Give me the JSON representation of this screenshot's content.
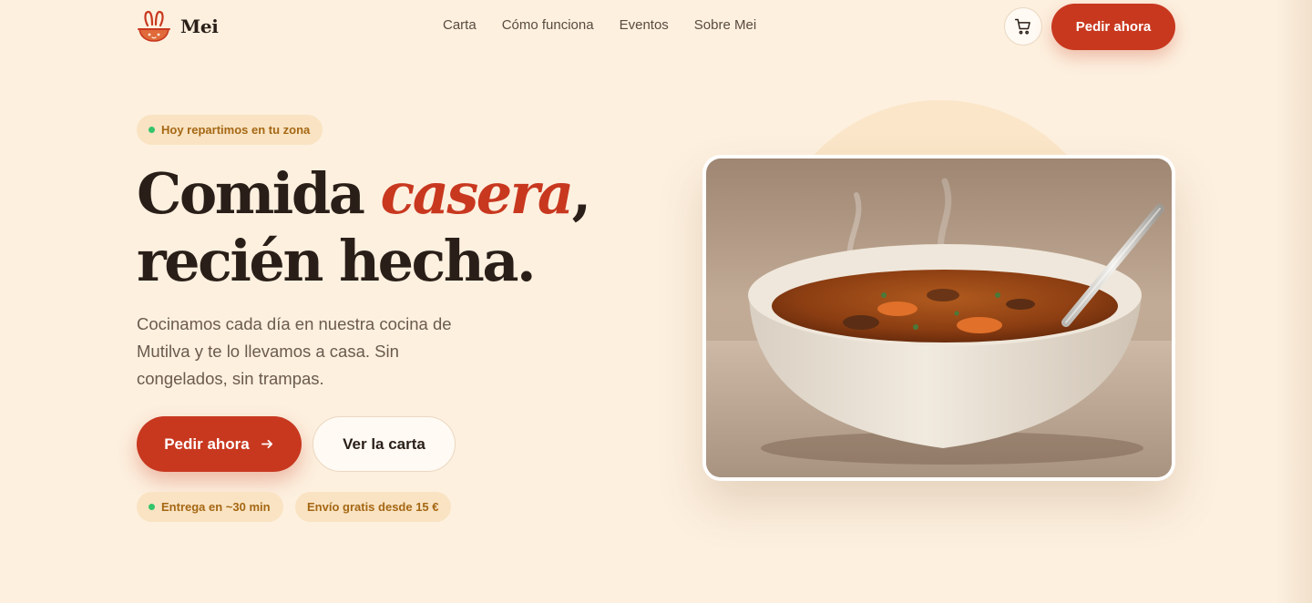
{
  "brand": {
    "name": "Mei",
    "logo_icon": "bowl-bunny-icon",
    "brand_color": "#c8381f"
  },
  "nav": {
    "links": [
      "Carta",
      "Cómo funciona",
      "Eventos",
      "Sobre Mei"
    ],
    "cart_icon": "cart-icon",
    "cta_label": "Pedir ahora"
  },
  "hero": {
    "badge": "Hoy repartimos en tu zona",
    "headline_part1": "Comida ",
    "headline_accent": "casera",
    "headline_part2": ",",
    "headline_line2": "recién hecha.",
    "subtext": "Cocinamos cada día en nuestra cocina de Mutilva y te lo llevamos a casa. Sin congelados, sin trampas.",
    "primary_cta": "Pedir ahora",
    "primary_cta_icon": "arrow-right-icon",
    "secondary_cta": "Ver la carta",
    "info_badges": [
      "Entrega en ~30 min",
      "Envío gratis desde 15 €"
    ],
    "image_subject": "bowl-of-vegetable-soup-photo"
  },
  "colors": {
    "background": "#fdf0df",
    "accent": "#c8381f",
    "badge_bg": "#f9e3c2",
    "badge_text": "#a56714",
    "status_dot": "#34c46a"
  }
}
